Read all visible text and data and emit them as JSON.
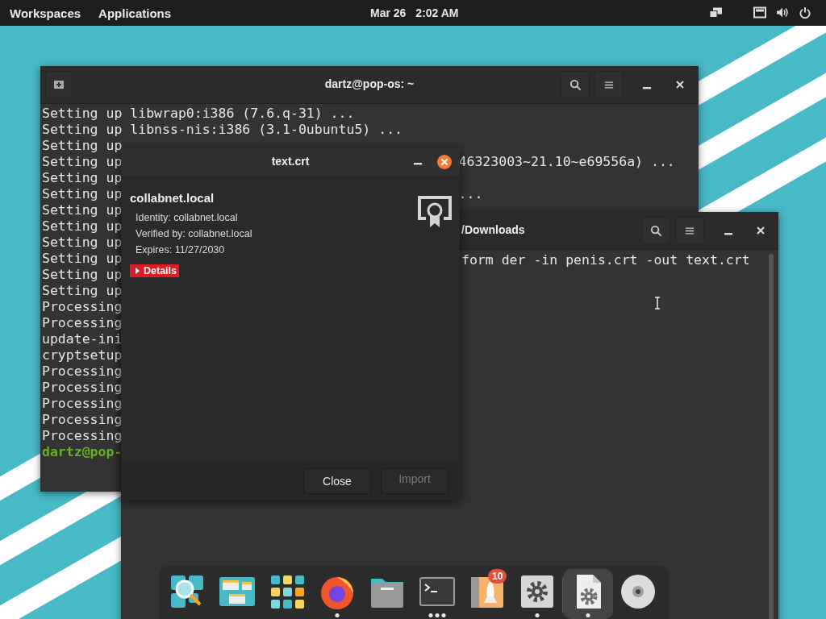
{
  "top_bar": {
    "workspaces": "Workspaces",
    "applications": "Applications",
    "date": "Mar 26",
    "time": "2:02 AM"
  },
  "terminal": {
    "title": "dartz@pop-os: ~",
    "lines": [
      {
        "kind": "output",
        "text": "Setting up libwrap0:i386 (7.6.q-31) ..."
      },
      {
        "kind": "output",
        "text": "Setting up libnss-nis:i386 (3.1-0ubuntu5) ..."
      },
      {
        "kind": "output",
        "text": "Setting up"
      },
      {
        "kind": "output",
        "text": "Setting up",
        "tail": "46323003~21.10~e69556a) ..."
      },
      {
        "kind": "output",
        "text": "Setting up"
      },
      {
        "kind": "output",
        "text": "Setting up",
        "tail": "..."
      },
      {
        "kind": "output",
        "text": "Setting up"
      },
      {
        "kind": "output",
        "text": "Setting up"
      },
      {
        "kind": "output",
        "text": "Setting up"
      },
      {
        "kind": "output",
        "text": "Setting up"
      },
      {
        "kind": "output",
        "text": "Setting up"
      },
      {
        "kind": "output",
        "text": "Setting up"
      },
      {
        "kind": "output",
        "text": "Processing"
      },
      {
        "kind": "output",
        "text": "Processing"
      },
      {
        "kind": "output",
        "text": "update-ini"
      },
      {
        "kind": "output",
        "text": "cryptsetup"
      },
      {
        "kind": "output",
        "text": "Processing"
      },
      {
        "kind": "output",
        "text": "Processing"
      },
      {
        "kind": "output",
        "text": "Processing"
      },
      {
        "kind": "output",
        "text": "Processing"
      },
      {
        "kind": "output",
        "text": "Processing"
      },
      {
        "kind": "prompt",
        "text": "dartz@pop-"
      }
    ]
  },
  "terminal_2": {
    "title": "/Downloads",
    "lines": [
      "form der -in penis.crt -out text.crt"
    ]
  },
  "dialog": {
    "title": "text.crt",
    "name": "collabnet.local",
    "fields": [
      "Identity: collabnet.local",
      "Verified by: collabnet.local",
      "Expires: 11/27/2030"
    ],
    "details": {
      "label": "Details",
      "expanded": false
    },
    "buttons": [
      {
        "label": "Close",
        "disabled": false
      },
      {
        "label": "Import",
        "disabled": true
      }
    ]
  },
  "dock": {
    "favorites": [
      {
        "kind": "launcher",
        "running": false,
        "selected": false
      },
      {
        "kind": "workspaces",
        "running": false,
        "selected": false
      },
      {
        "kind": "apps",
        "running": false,
        "selected": false
      },
      {
        "kind": "browser",
        "running": true,
        "several": false,
        "selected": false
      },
      {
        "kind": "files",
        "running": false,
        "selected": false
      },
      {
        "kind": "terminal",
        "running": true,
        "several": true,
        "selected": false
      },
      {
        "kind": "shop",
        "running": false,
        "selected": false,
        "badge": "10"
      },
      {
        "kind": "settings",
        "running": true,
        "several": false,
        "selected": false
      }
    ],
    "others": [
      {
        "kind": "document",
        "running": true,
        "several": false,
        "selected": true
      },
      {
        "kind": "disc",
        "running": false,
        "selected": false
      }
    ]
  }
}
